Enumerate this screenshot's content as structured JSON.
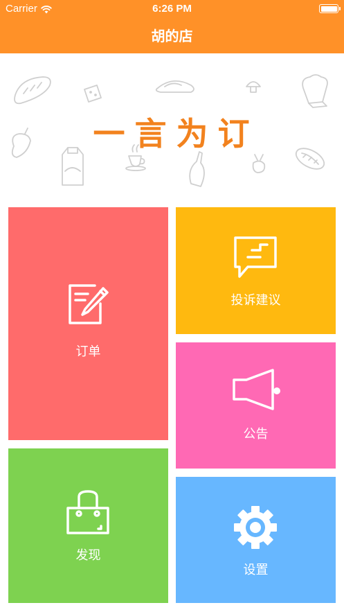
{
  "status_bar": {
    "carrier": "Carrier",
    "time": "6:26 PM"
  },
  "nav": {
    "title": "胡的店"
  },
  "banner": {
    "slogan": "一言为订"
  },
  "tiles": {
    "order": {
      "label": "订单",
      "icon": "edit-icon",
      "color": "#FF6B6B"
    },
    "feedback": {
      "label": "投诉建议",
      "icon": "message-icon",
      "color": "#FFB90F"
    },
    "notice": {
      "label": "公告",
      "icon": "megaphone-icon",
      "color": "#FF69B4"
    },
    "discover": {
      "label": "发现",
      "icon": "bag-icon",
      "color": "#7ED250"
    },
    "settings": {
      "label": "设置",
      "icon": "gear-icon",
      "color": "#67B7FF"
    }
  },
  "theme": {
    "header_color": "#FF9128",
    "slogan_color": "#F2821E"
  }
}
